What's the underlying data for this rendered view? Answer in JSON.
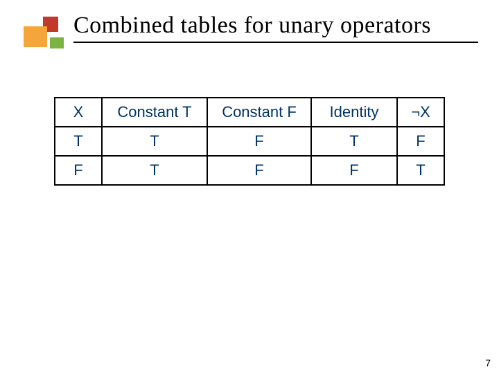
{
  "slide": {
    "title": "Combined tables for unary operators",
    "page_number": "7"
  },
  "table": {
    "headers": [
      "X",
      "Constant T",
      "Constant F",
      "Identity",
      "¬X"
    ],
    "rows": [
      [
        "T",
        "T",
        "F",
        "T",
        "F"
      ],
      [
        "F",
        "T",
        "F",
        "F",
        "T"
      ]
    ]
  },
  "chart_data": {
    "type": "table",
    "title": "Combined tables for unary operators",
    "columns": [
      "X",
      "Constant T",
      "Constant F",
      "Identity",
      "¬X"
    ],
    "rows": [
      {
        "X": "T",
        "Constant T": "T",
        "Constant F": "F",
        "Identity": "T",
        "¬X": "F"
      },
      {
        "X": "F",
        "Constant T": "T",
        "Constant F": "F",
        "Identity": "F",
        "¬X": "T"
      }
    ]
  }
}
